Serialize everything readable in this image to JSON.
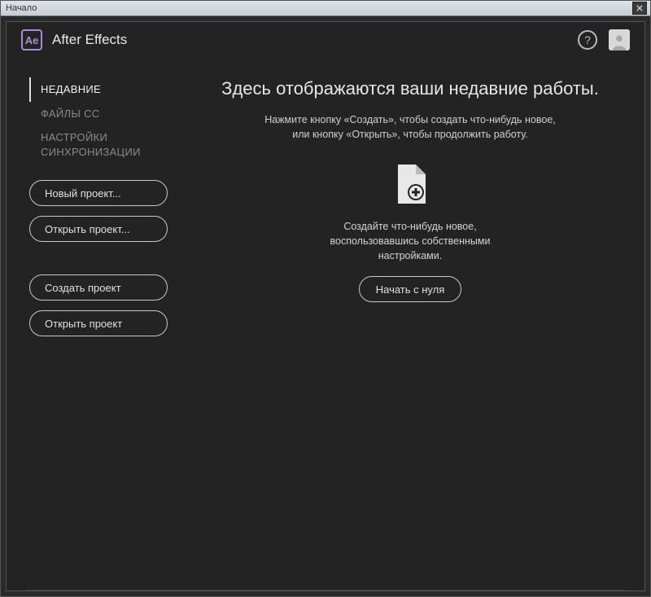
{
  "window": {
    "title": "Начало"
  },
  "header": {
    "logo_text": "Ae",
    "app_title": "After Effects",
    "help_label": "?"
  },
  "sidebar": {
    "items": [
      {
        "label": "НЕДАВНИЕ",
        "active": true
      },
      {
        "label": "ФАЙЛЫ CC",
        "active": false
      },
      {
        "label": "НАСТРОЙКИ СИНХРОНИЗАЦИИ",
        "active": false
      }
    ],
    "buttons_primary": [
      "Новый проект...",
      "Открыть проект..."
    ],
    "buttons_secondary": [
      "Создать проект",
      "Открыть проект"
    ]
  },
  "main": {
    "heading": "Здесь отображаются ваши недавние работы.",
    "subtitle": "Нажмите кнопку «Создать», чтобы создать что-нибудь новое, или кнопку «Открыть», чтобы продолжить работу.",
    "instruction": "Создайте что-нибудь новое, воспользовавшись собственными настройками.",
    "start_button": "Начать с нуля"
  }
}
